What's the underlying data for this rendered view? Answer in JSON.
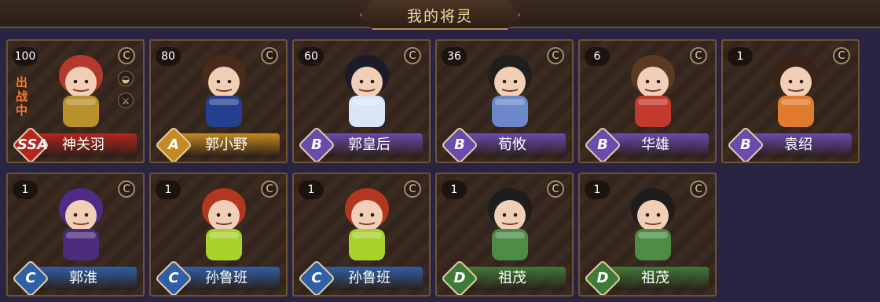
{
  "header": {
    "title": "我的将灵"
  },
  "colors": {
    "grade_SSA": "#b3261e",
    "grade_A": "#c58a22",
    "grade_B": "#6a4bb0",
    "grade_C": "#2f5fa6",
    "grade_D": "#3f7a3a"
  },
  "cards": [
    {
      "level": "100",
      "name": "神关羽",
      "grade": "SSA",
      "deploy_label": "出战中",
      "has_deploy": true
    },
    {
      "level": "80",
      "name": "郭小野",
      "grade": "A"
    },
    {
      "level": "60",
      "name": "郭皇后",
      "grade": "B"
    },
    {
      "level": "36",
      "name": "荀攸",
      "grade": "B"
    },
    {
      "level": "6",
      "name": "华雄",
      "grade": "B"
    },
    {
      "level": "1",
      "name": "袁绍",
      "grade": "B"
    },
    {
      "level": "1",
      "name": "郭淮",
      "grade": "C"
    },
    {
      "level": "1",
      "name": "孙鲁班",
      "grade": "C"
    },
    {
      "level": "1",
      "name": "孙鲁班",
      "grade": "C"
    },
    {
      "level": "1",
      "name": "祖茂",
      "grade": "D"
    },
    {
      "level": "1",
      "name": "祖茂",
      "grade": "D"
    }
  ],
  "icons": {
    "c_icon": "C",
    "coin_icon": "◒",
    "sword_icon": "⚔"
  }
}
